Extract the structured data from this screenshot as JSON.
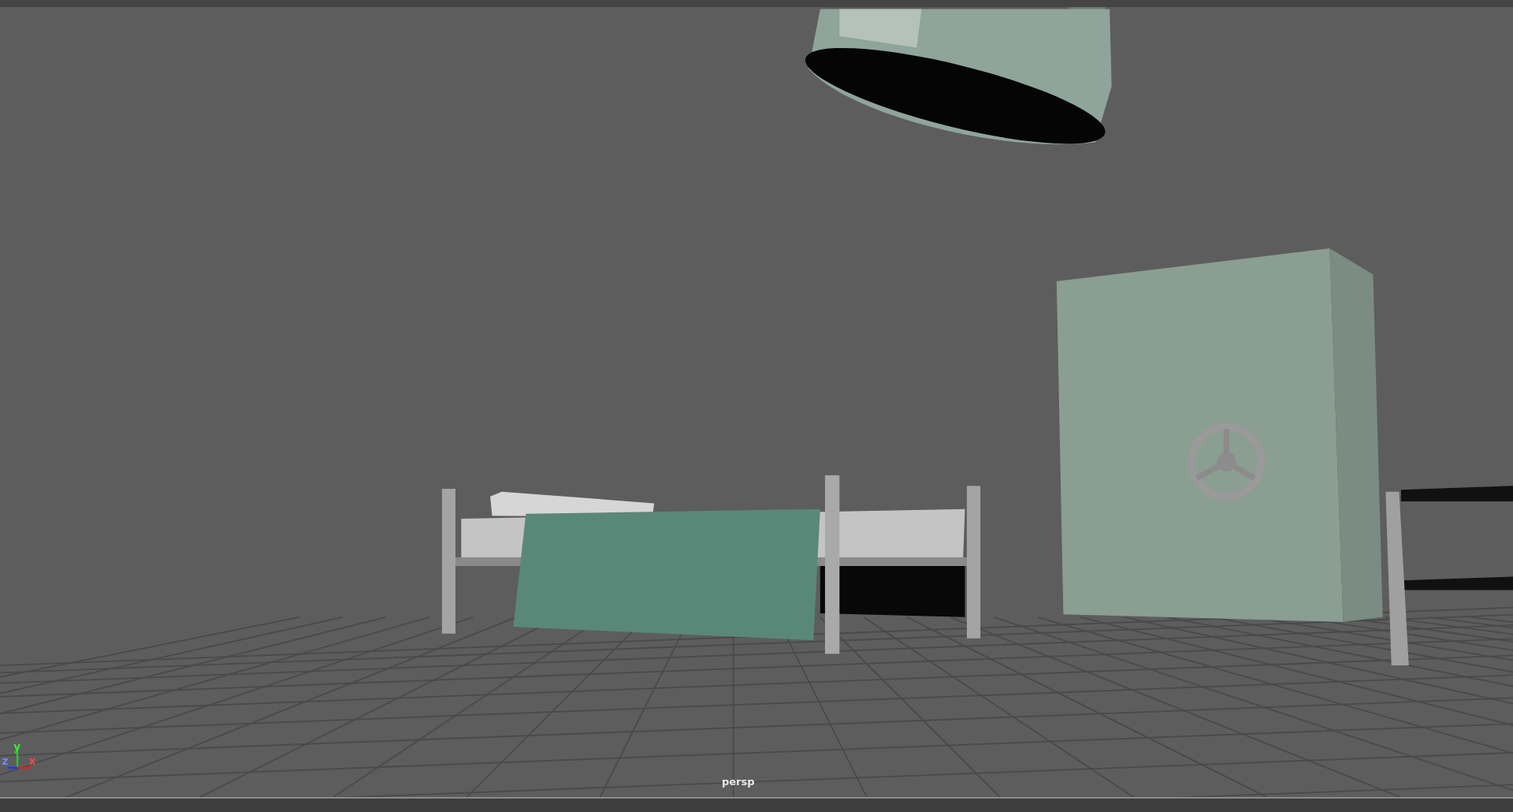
{
  "viewport": {
    "camera_label": "persp",
    "axis_labels": {
      "x": "x",
      "y": "y",
      "z": "z"
    }
  }
}
